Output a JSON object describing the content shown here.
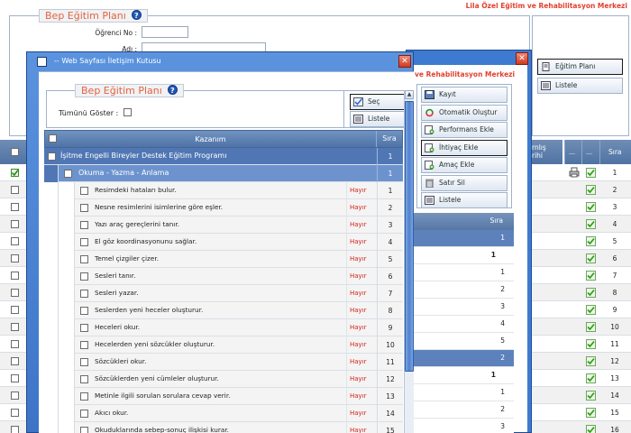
{
  "background": {
    "brand": "Lila Özel Eğitim ve Rehabilitasyon Merkezi",
    "section_title": "Bep Eğitim Planı",
    "fields": [
      {
        "label": "Öğrenci No :"
      },
      {
        "label": "Adı :"
      }
    ],
    "right_buttons": [
      {
        "label": "Eğitim Planı",
        "icon": "document-icon"
      },
      {
        "label": "Listele",
        "icon": "list-icon"
      }
    ],
    "grid_headers": [
      "...",
      "...",
      "Sıra"
    ],
    "grid_header_partial": "rnlış\nrihi",
    "row_numbers": [
      "1",
      "2",
      "3",
      "4",
      "5",
      "6",
      "7",
      "8",
      "9",
      "10",
      "11",
      "12",
      "13",
      "14",
      "15",
      "16"
    ]
  },
  "back_dialog": {
    "title": "ve Rehabilitasyon Merkezi",
    "buttons": [
      {
        "label": "Kayıt",
        "icon": "save-icon"
      },
      {
        "label": "Otomatik Oluştur",
        "icon": "refresh-icon"
      },
      {
        "label": "Performans Ekle",
        "icon": "add-icon"
      },
      {
        "label": "İhtiyaç Ekle",
        "icon": "add-icon"
      },
      {
        "label": "Amaç Ekle",
        "icon": "add-icon"
      },
      {
        "label": "Satır Sil",
        "icon": "trash-icon"
      },
      {
        "label": "Listele",
        "icon": "list-icon"
      }
    ],
    "grid_header": "Sıra",
    "rows": [
      {
        "value": "1",
        "group": true
      },
      {
        "value": "1",
        "group": false
      },
      {
        "value": "1",
        "group": false
      },
      {
        "value": "2",
        "group": false
      },
      {
        "value": "3",
        "group": false
      },
      {
        "value": "4",
        "group": false
      },
      {
        "value": "5",
        "group": false
      },
      {
        "value": "2",
        "group": true
      },
      {
        "value": "1",
        "group": false
      },
      {
        "value": "1",
        "group": false
      },
      {
        "value": "2",
        "group": false
      },
      {
        "value": "3",
        "group": false
      }
    ]
  },
  "dialog": {
    "title": "-- Web Sayfası İletişim Kutusu",
    "section_title": "Bep Eğitim Planı",
    "show_all_label": "Tümünü Göster :",
    "select_button": "Seç",
    "list_button": "Listele",
    "grid": {
      "col_kazanim": "Kazanım",
      "col_sira": "Sıra",
      "group": {
        "label": "İşitme Engelli Bireyler Destek Eğitim Programı",
        "sira": "1"
      },
      "subgroup": {
        "label": "Okuma - Yazma - Anlama",
        "sira": "1"
      },
      "items": [
        {
          "text": "Resimdeki hataları bulur.",
          "status": "Hayır",
          "sira": "1"
        },
        {
          "text": "Nesne resimlerini isimlerine göre eşler.",
          "status": "Hayır",
          "sira": "2"
        },
        {
          "text": "Yazı araç gereçlerini tanır.",
          "status": "Hayır",
          "sira": "3"
        },
        {
          "text": "El göz koordinasyonunu sağlar.",
          "status": "Hayır",
          "sira": "4"
        },
        {
          "text": "Temel çizgiler çizer.",
          "status": "Hayır",
          "sira": "5"
        },
        {
          "text": "Sesleri tanır.",
          "status": "Hayır",
          "sira": "6"
        },
        {
          "text": "Sesleri yazar.",
          "status": "Hayır",
          "sira": "7"
        },
        {
          "text": "Seslerden yeni heceler oluşturur.",
          "status": "Hayır",
          "sira": "8"
        },
        {
          "text": "Heceleri okur.",
          "status": "Hayır",
          "sira": "9"
        },
        {
          "text": "Hecelerden yeni sözcükler oluşturur.",
          "status": "Hayır",
          "sira": "10"
        },
        {
          "text": "Sözcükleri okur.",
          "status": "Hayır",
          "sira": "11"
        },
        {
          "text": "Sözcüklerden yeni cümleler oluşturur.",
          "status": "Hayır",
          "sira": "12"
        },
        {
          "text": "Metinle ilgili sorulan sorulara cevap verir.",
          "status": "Hayır",
          "sira": "13"
        },
        {
          "text": "Akıcı okur.",
          "status": "Hayır",
          "sira": "14"
        },
        {
          "text": "Okuduklarında sebep-sonuç ilişkisi kurar.",
          "status": "Hayır",
          "sira": "15"
        }
      ]
    }
  }
}
